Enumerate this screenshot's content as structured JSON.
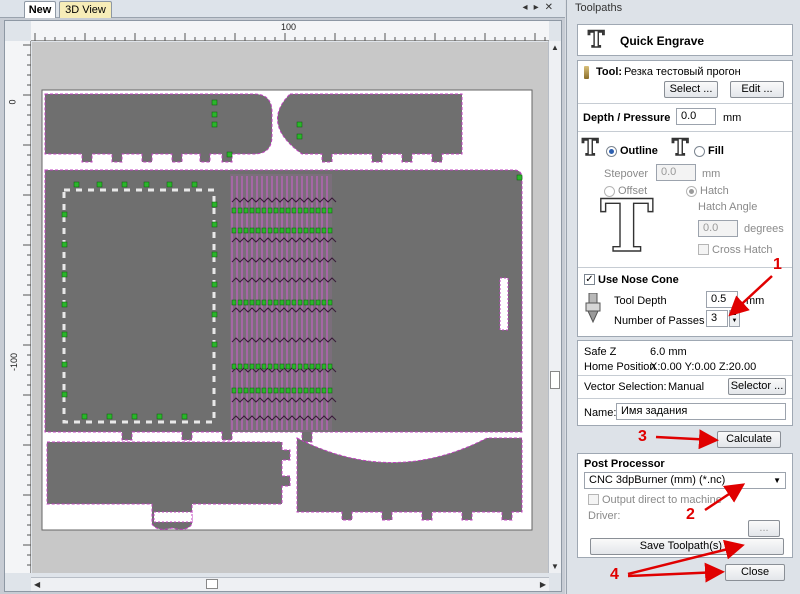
{
  "tabs": [
    {
      "label": "New",
      "active": true
    },
    {
      "label": "3D View",
      "active": false
    }
  ],
  "ruler": {
    "top_label": "100",
    "left_labels": [
      "0",
      "-100"
    ]
  },
  "panel": {
    "title": "Toolpaths",
    "toolpath_name": "Quick Engrave",
    "tool": {
      "label": "Tool:",
      "value": "Резка тестовый прогон",
      "select_button": "Select ...",
      "edit_button": "Edit ..."
    },
    "depth": {
      "label": "Depth / Pressure",
      "value": "0.0",
      "unit": "mm"
    },
    "mode": {
      "outline_label": "Outline",
      "fill_label": "Fill",
      "selected": "Outline",
      "stepover_label": "Stepover",
      "stepover_value": "0.0",
      "stepover_unit": "mm",
      "offset_label": "Offset",
      "hatch_label": "Hatch",
      "hatch_selected": true,
      "hatch_angle_label": "Hatch Angle",
      "hatch_angle_value": "0.0",
      "hatch_angle_unit": "degrees",
      "cross_hatch_label": "Cross Hatch",
      "big_letter": "T"
    },
    "nose_cone": {
      "label": "Use Nose Cone",
      "checked": true,
      "tool_depth_label": "Tool Depth",
      "tool_depth_value": "0.5",
      "tool_depth_unit": "mm",
      "passes_label": "Number of Passes",
      "passes_value": "3"
    },
    "info": {
      "safe_z_label": "Safe Z",
      "safe_z_value": "6.0 mm",
      "home_label": "Home Position",
      "home_value": "X:0.00 Y:0.00 Z:20.00",
      "vector_sel_label": "Vector Selection:",
      "vector_sel_value": "Manual",
      "selector_button": "Selector ...",
      "name_label": "Name:",
      "name_value": "Имя задания"
    },
    "calculate_button": "Calculate",
    "post": {
      "title": "Post Processor",
      "selected": "CNC 3dpBurner (mm) (*.nc)",
      "output_direct_label": "Output direct to machine",
      "driver_label": "Driver:",
      "driver_button": "...",
      "save_button": "Save Toolpath(s) ..."
    },
    "close_button": "Close"
  },
  "annotations": [
    "1",
    "2",
    "3",
    "4"
  ],
  "colors": {
    "annotation": "#e00000",
    "part_fill": "#6f6f6f",
    "toolpath": "#c040c0",
    "tab_marker": "#2bb52b"
  }
}
